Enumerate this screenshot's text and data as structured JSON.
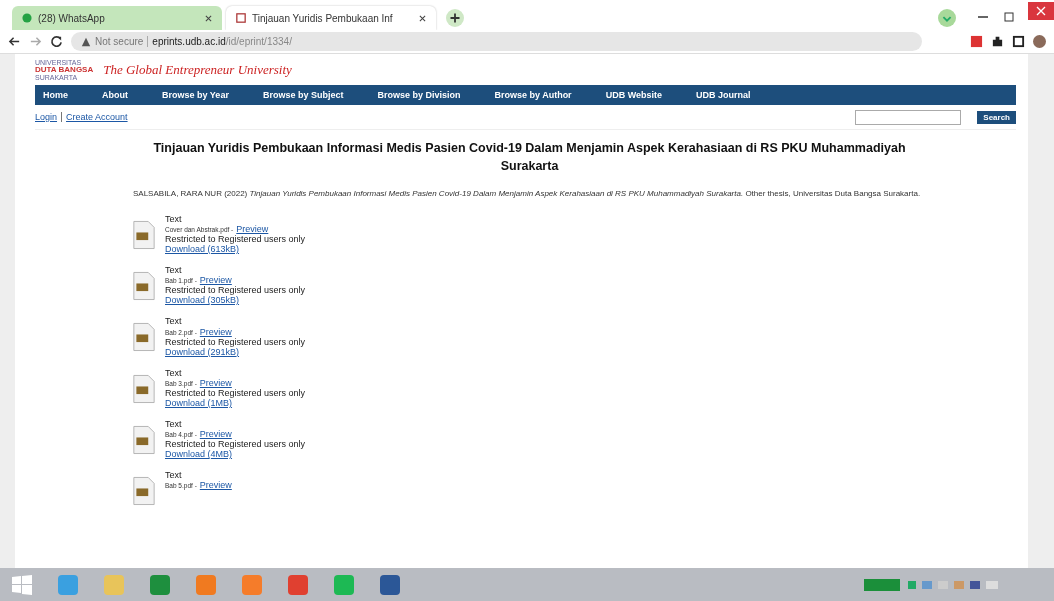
{
  "browser": {
    "tabs": [
      {
        "label": "(28) WhatsApp",
        "selected": false,
        "kind": "whatsapp"
      },
      {
        "label": "Tinjauan Yuridis Pembukaan Inf",
        "selected": true,
        "kind": "page"
      }
    ],
    "security": "Not secure",
    "url_host": "eprints.udb.ac.id",
    "url_path": "/id/eprint/1334/"
  },
  "site": {
    "logo_lines": [
      "UNIVERSITAS",
      "DUTA BANGSA",
      "SURAKARTA"
    ],
    "tagline": "The Global Entrepreneur University",
    "nav": [
      "Home",
      "About",
      "Browse by Year",
      "Browse by Subject",
      "Browse by Division",
      "Browse by Author",
      "UDB Website",
      "UDB Journal"
    ],
    "login": "Login",
    "create_account": "Create Account",
    "search_button": "Search"
  },
  "record": {
    "title": "Tinjauan Yuridis Pembukaan Informasi Medis Pasien Covid-19 Dalam Menjamin Aspek Kerahasiaan di RS PKU Muhammadiyah Surakarta",
    "citation": "SALSABILA, RARA NUR (2022) *Tinjauan Yuridis Pembukaan Informasi Medis Pasien Covid-19 Dalam Menjamin Aspek Kerahasiaan di RS PKU Muhammadiyah Surakarta.* Other thesis, Universitas Duta Bangsa Surakarta.",
    "documents": [
      {
        "type": "Text",
        "file": "Cover dan Abstrak.pdf -",
        "preview": "Preview",
        "restriction": "Restricted to Registered users only",
        "download": "Download (613kB)"
      },
      {
        "type": "Text",
        "file": "Bab 1.pdf -",
        "preview": "Preview",
        "restriction": "Restricted to Registered users only",
        "download": "Download (305kB)"
      },
      {
        "type": "Text",
        "file": "Bab 2.pdf -",
        "preview": "Preview",
        "restriction": "Restricted to Registered users only",
        "download": "Download (291kB)"
      },
      {
        "type": "Text",
        "file": "Bab 3.pdf -",
        "preview": "Preview",
        "restriction": "Restricted to Registered users only",
        "download": "Download (1MB)"
      },
      {
        "type": "Text",
        "file": "Bab 4.pdf -",
        "preview": "Preview",
        "restriction": "Restricted to Registered users only",
        "download": "Download (4MB)"
      },
      {
        "type": "Text",
        "file": "Bab 5.pdf -",
        "preview": "Preview"
      }
    ]
  },
  "taskbar": {
    "apps": [
      {
        "kind": "start"
      },
      {
        "kind": "ie"
      },
      {
        "kind": "files"
      },
      {
        "kind": "sheets"
      },
      {
        "kind": "firefox"
      },
      {
        "kind": "xampp"
      },
      {
        "kind": "chrome"
      },
      {
        "kind": "spotify"
      },
      {
        "kind": "word"
      }
    ]
  }
}
